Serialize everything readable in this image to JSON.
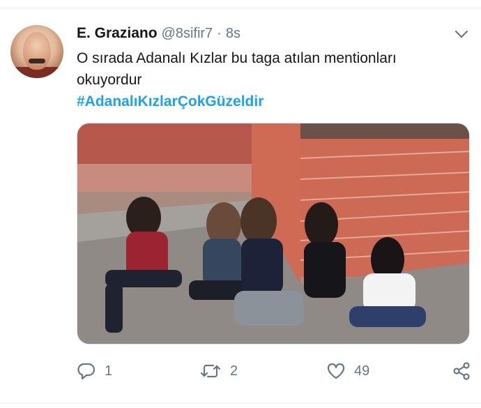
{
  "tweet": {
    "author_name": "E. Graziano",
    "handle": "@8sifir7",
    "separator": "·",
    "time": "8s",
    "text": "O sırada Adanalı Kızlar bu taga atılan mentionları okuyordur",
    "hashtag": "#AdanalıKızlarÇokGüzeldir"
  },
  "actions": {
    "reply_count": "1",
    "retweet_count": "2",
    "like_count": "49"
  },
  "icons": {
    "menu": "chevron-down-icon",
    "reply": "reply-icon",
    "retweet": "retweet-icon",
    "like": "heart-icon",
    "share": "share-icon"
  },
  "colors": {
    "link": "#1da1f2",
    "secondary_text": "#657786",
    "primary_text": "#14171a"
  }
}
